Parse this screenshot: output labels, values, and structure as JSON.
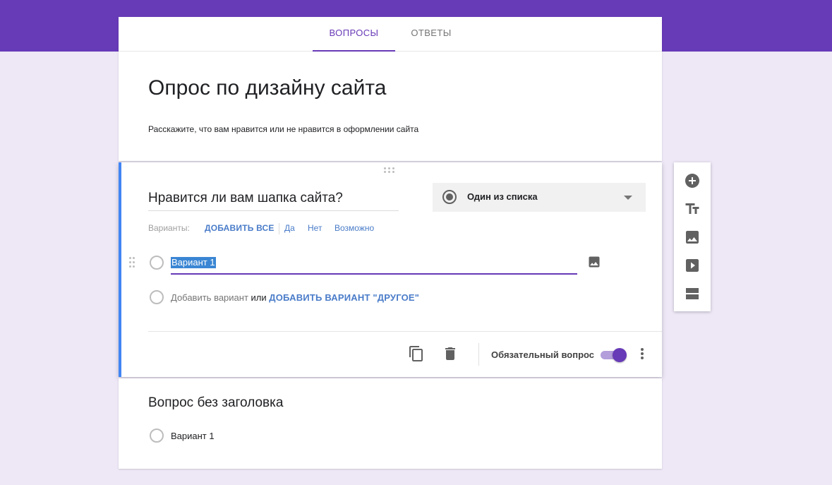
{
  "tabs": [
    {
      "label": "ВОПРОСЫ",
      "active": true
    },
    {
      "label": "ОТВЕТЫ",
      "active": false
    }
  ],
  "form": {
    "title": "Опрос по дизайну сайта",
    "description": "Расскажите, что вам нравится или не нравится в оформлении сайта"
  },
  "question1": {
    "title": "Нравится ли вам шапка сайта?",
    "type_label": "Один из списка",
    "variants_label": "Варианты:",
    "add_all_label": "ДОБАВИТЬ ВСЕ",
    "suggestions": [
      "Да",
      "Нет",
      "Возможно"
    ],
    "option1": "Вариант 1",
    "add_option_label": "Добавить вариант",
    "or_label": "или",
    "add_other_label": "ДОБАВИТЬ ВАРИАНТ \"ДРУГОЕ\"",
    "required_label": "Обязательный вопрос",
    "required": true
  },
  "question2": {
    "title": "Вопрос без заголовка",
    "option1": "Вариант 1"
  },
  "toolbar": {
    "items": [
      "add-question-icon",
      "title-text-icon",
      "image-icon",
      "video-icon",
      "section-icon"
    ]
  },
  "colors": {
    "accent": "#673ab7",
    "background": "#ede7f6",
    "link": "#4a7cc9",
    "active_card_border": "#4285f4"
  }
}
